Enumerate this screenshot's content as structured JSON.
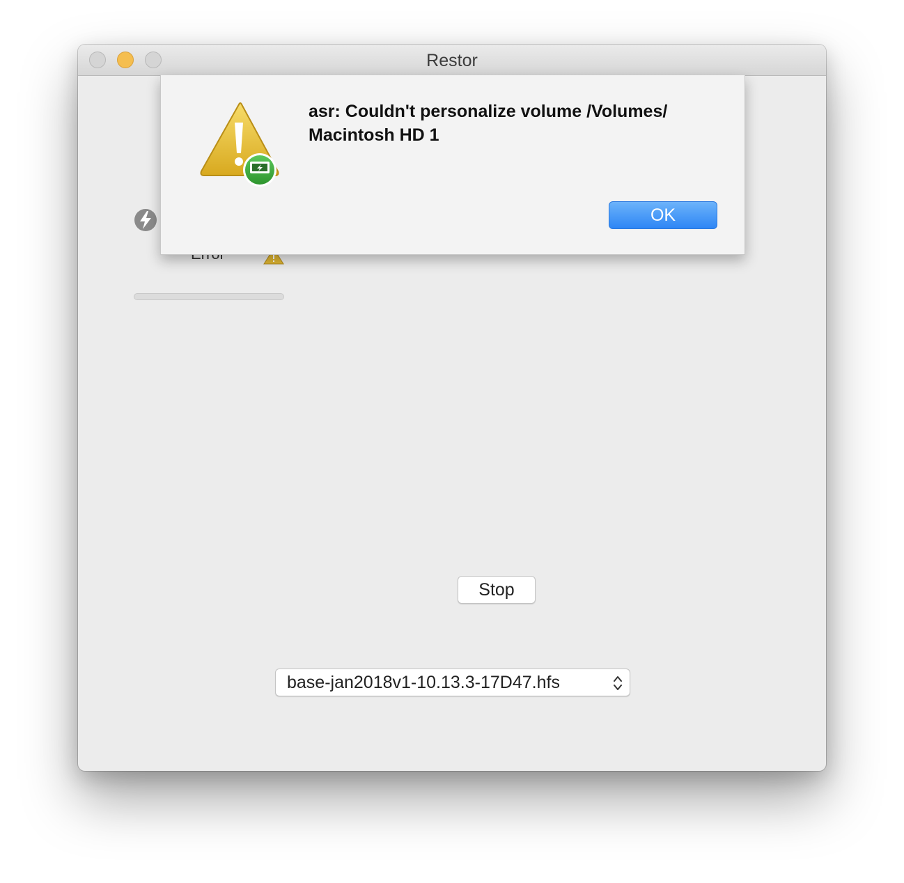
{
  "window": {
    "title": "Restor"
  },
  "alert": {
    "message": "asr: Couldn't personalize volume /Volumes/ Macintosh HD 1",
    "ok_label": "OK",
    "icon": "caution-triangle-icon"
  },
  "main": {
    "status_text": "Error",
    "status_icon": "bolt-icon",
    "warning_icon": "warning-icon",
    "stop_label": "Stop",
    "image_select_value": "base-jan2018v1-10.13.3-17D47.hfs",
    "progress": 0
  },
  "colors": {
    "accent": "#2e86f5",
    "minimize": "#f5be4f",
    "warning": "#e8c13a",
    "badge": "#3aa53a"
  }
}
